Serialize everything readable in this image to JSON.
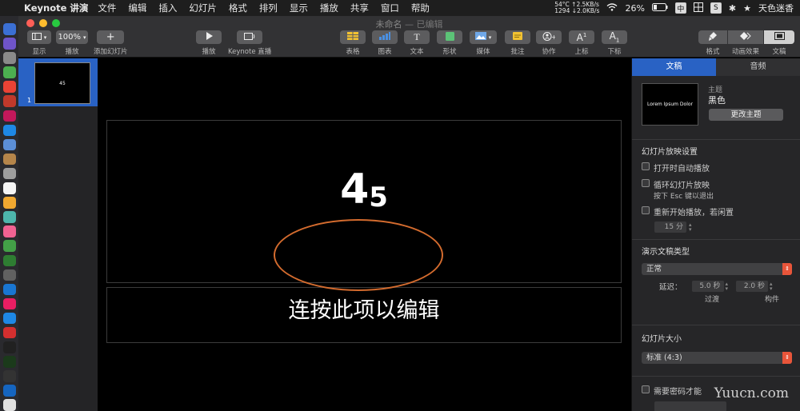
{
  "menubar": {
    "app": "Keynote 讲演",
    "items": [
      "文件",
      "编辑",
      "插入",
      "幻灯片",
      "格式",
      "排列",
      "显示",
      "播放",
      "共享",
      "窗口",
      "帮助"
    ],
    "temp": "54°C",
    "fan": "1294",
    "net_up": "↑2.5KB/s",
    "net_down": "↓2.0KB/s",
    "battery": "26%",
    "input_badge": "中",
    "s_badge": "S",
    "user": "天色迷香"
  },
  "window": {
    "title": "未命名",
    "title_status": "— 已编辑"
  },
  "toolbar": {
    "view": "显示",
    "zoom_value": "100%",
    "zoom": "播放",
    "add_slide": "添加幻灯片",
    "play": "播放",
    "keynote_live": "Keynote 直播",
    "table": "表格",
    "chart": "图表",
    "text": "文本",
    "shape": "形状",
    "media": "媒体",
    "comment": "批注",
    "collaborate": "协作",
    "superscript": "上标",
    "subscript": "下标",
    "format": "格式",
    "animate": "动画效果",
    "document": "文稿"
  },
  "navigator": {
    "slide_number": "1",
    "thumb_text": "45"
  },
  "slide": {
    "title_main": "4",
    "title_sub": "5",
    "subtitle": "连按此项以编辑"
  },
  "inspector": {
    "tab_document": "文稿",
    "tab_audio": "音频",
    "theme_label": "主题",
    "theme_name": "黑色",
    "theme_preview_text": "Lorem Ipsum Dolor",
    "change_theme": "更改主题",
    "playback_title": "幻灯片放映设置",
    "autoplay": "打开时自动播放",
    "loop": "循环幻灯片放映",
    "loop_hint": "按下 Esc 键以退出",
    "restart": "重新开始播放，若闲置",
    "idle_value": "15 分",
    "presentation_type_title": "演示文稿类型",
    "presentation_type": "正常",
    "delay_label": "延迟：",
    "transition_value": "5.0 秒",
    "build_value": "2.0 秒",
    "transition_label": "过渡",
    "build_label": "构件",
    "slide_size_title": "幻灯片大小",
    "slide_size": "标准 (4:3)",
    "password": "需要密码才能"
  },
  "watermark": "Yuucn.com",
  "colors": {
    "accent": "#2962c4",
    "annotation": "#d36b2e",
    "popup_arrow": "#e8553a"
  }
}
